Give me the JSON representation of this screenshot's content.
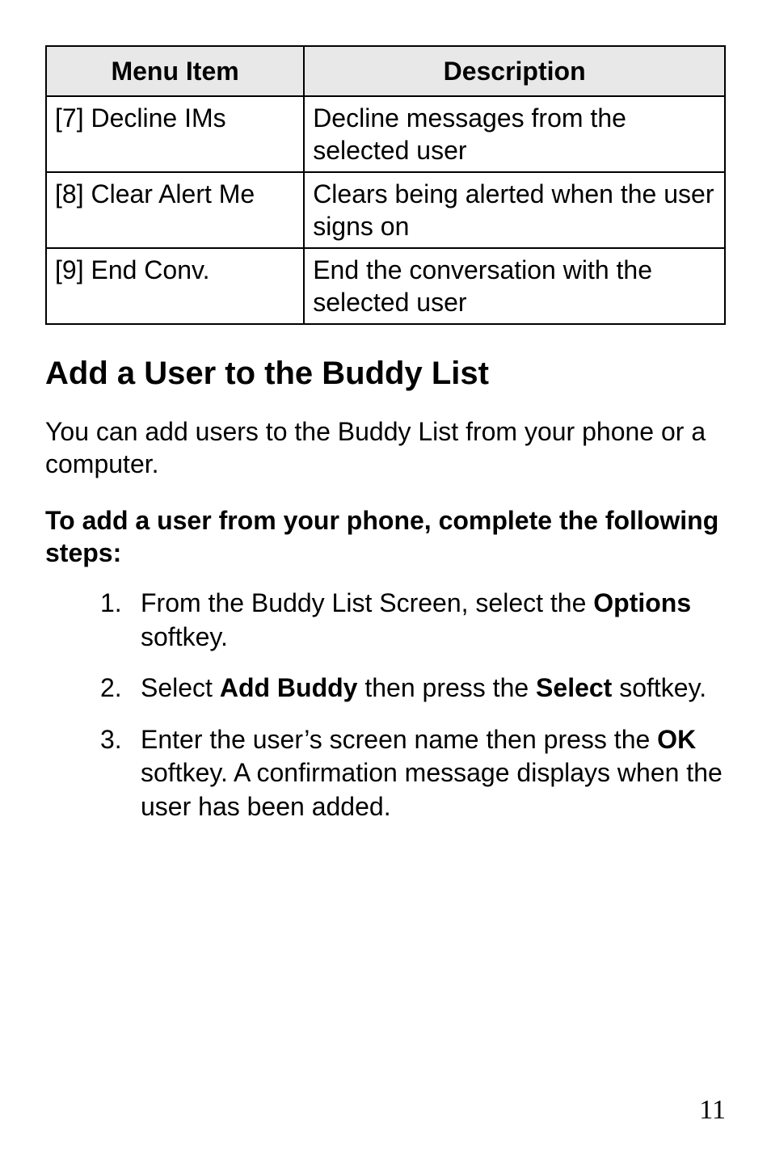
{
  "table": {
    "headers": {
      "menu": "Menu Item",
      "desc": "Description"
    },
    "rows": [
      {
        "menu": "[7] Decline IMs",
        "desc": "Decline messages from the selected user"
      },
      {
        "menu": "[8] Clear Alert Me",
        "desc": "Clears being alerted when the user signs on"
      },
      {
        "menu": "[9] End Conv.",
        "desc": "End the conversation with the selected user"
      }
    ]
  },
  "heading": "Add a User to the Buddy List",
  "intro": "You can add users to the Buddy List from your phone or a computer.",
  "subhead": "To add a user from your phone, complete the following steps:",
  "steps": {
    "s1": {
      "num": "1.",
      "t1": "From the Buddy List Screen, select the ",
      "b1": "Options",
      "t2": " softkey."
    },
    "s2": {
      "num": "2.",
      "t1": "Select ",
      "b1": "Add Buddy",
      "t2": " then press the ",
      "b2": "Select",
      "t3": " softkey."
    },
    "s3": {
      "num": "3.",
      "t1": "Enter the user’s screen name then press the ",
      "b1": "OK",
      "t2": " softkey. A confirmation message displays when the user has been added."
    }
  },
  "page_number": "11"
}
